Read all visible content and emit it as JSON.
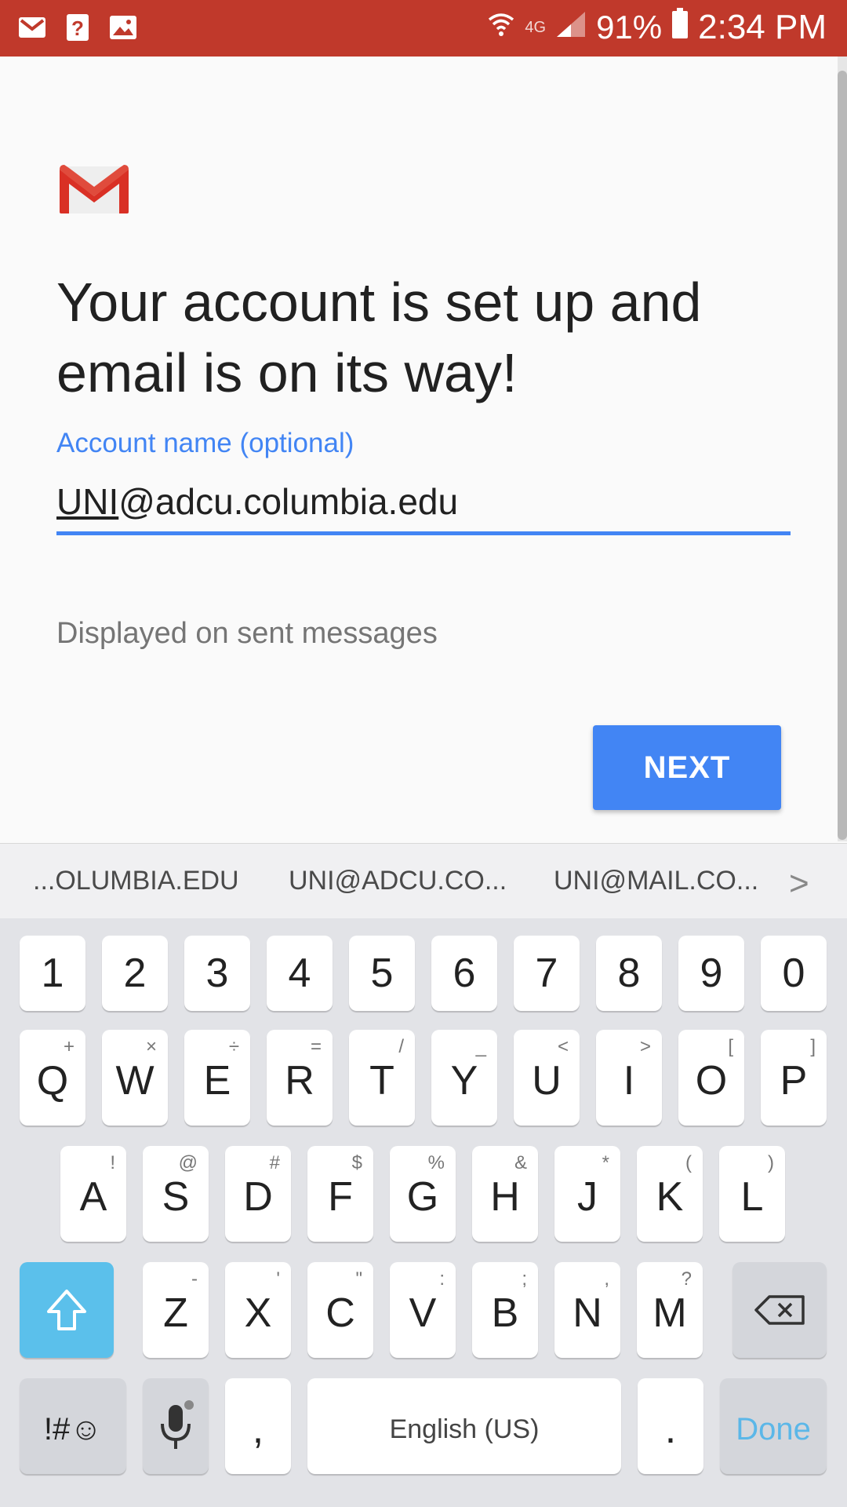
{
  "status_bar": {
    "network": "4G",
    "battery": "91%",
    "time": "2:34 PM",
    "bg_color": "#c0392b"
  },
  "main": {
    "headline": "Your account is set up and email is on its way!",
    "field_label": "Account name (optional)",
    "field_value_underlined": "UNI",
    "field_value_rest": "@adcu.columbia.edu",
    "helper": "Displayed on sent messages",
    "next_label": "NEXT",
    "accent": "#4285f4"
  },
  "keyboard": {
    "suggestions": [
      "...OLUMBIA.EDU",
      "UNI@ADCU.CO...",
      "UNI@MAIL.CO..."
    ],
    "suggestion_arrow": ">",
    "numbers": [
      "1",
      "2",
      "3",
      "4",
      "5",
      "6",
      "7",
      "8",
      "9",
      "0"
    ],
    "row1": [
      {
        "k": "Q",
        "h": "+"
      },
      {
        "k": "W",
        "h": "×"
      },
      {
        "k": "E",
        "h": "÷"
      },
      {
        "k": "R",
        "h": "="
      },
      {
        "k": "T",
        "h": "/"
      },
      {
        "k": "Y",
        "h": "_"
      },
      {
        "k": "U",
        "h": "<"
      },
      {
        "k": "I",
        "h": ">"
      },
      {
        "k": "O",
        "h": "["
      },
      {
        "k": "P",
        "h": "]"
      }
    ],
    "row2": [
      {
        "k": "A",
        "h": "!"
      },
      {
        "k": "S",
        "h": "@"
      },
      {
        "k": "D",
        "h": "#"
      },
      {
        "k": "F",
        "h": "$"
      },
      {
        "k": "G",
        "h": "%"
      },
      {
        "k": "H",
        "h": "&"
      },
      {
        "k": "J",
        "h": "*"
      },
      {
        "k": "K",
        "h": "("
      },
      {
        "k": "L",
        "h": ")"
      }
    ],
    "row3": [
      {
        "k": "Z",
        "h": "-"
      },
      {
        "k": "X",
        "h": "'"
      },
      {
        "k": "C",
        "h": "\""
      },
      {
        "k": "V",
        "h": ":"
      },
      {
        "k": "B",
        "h": ";"
      },
      {
        "k": "N",
        "h": ","
      },
      {
        "k": "M",
        "h": "?"
      }
    ],
    "symbols_label": "!#☺",
    "comma": ",",
    "space_label": "English (US)",
    "period": ".",
    "done_label": "Done"
  }
}
